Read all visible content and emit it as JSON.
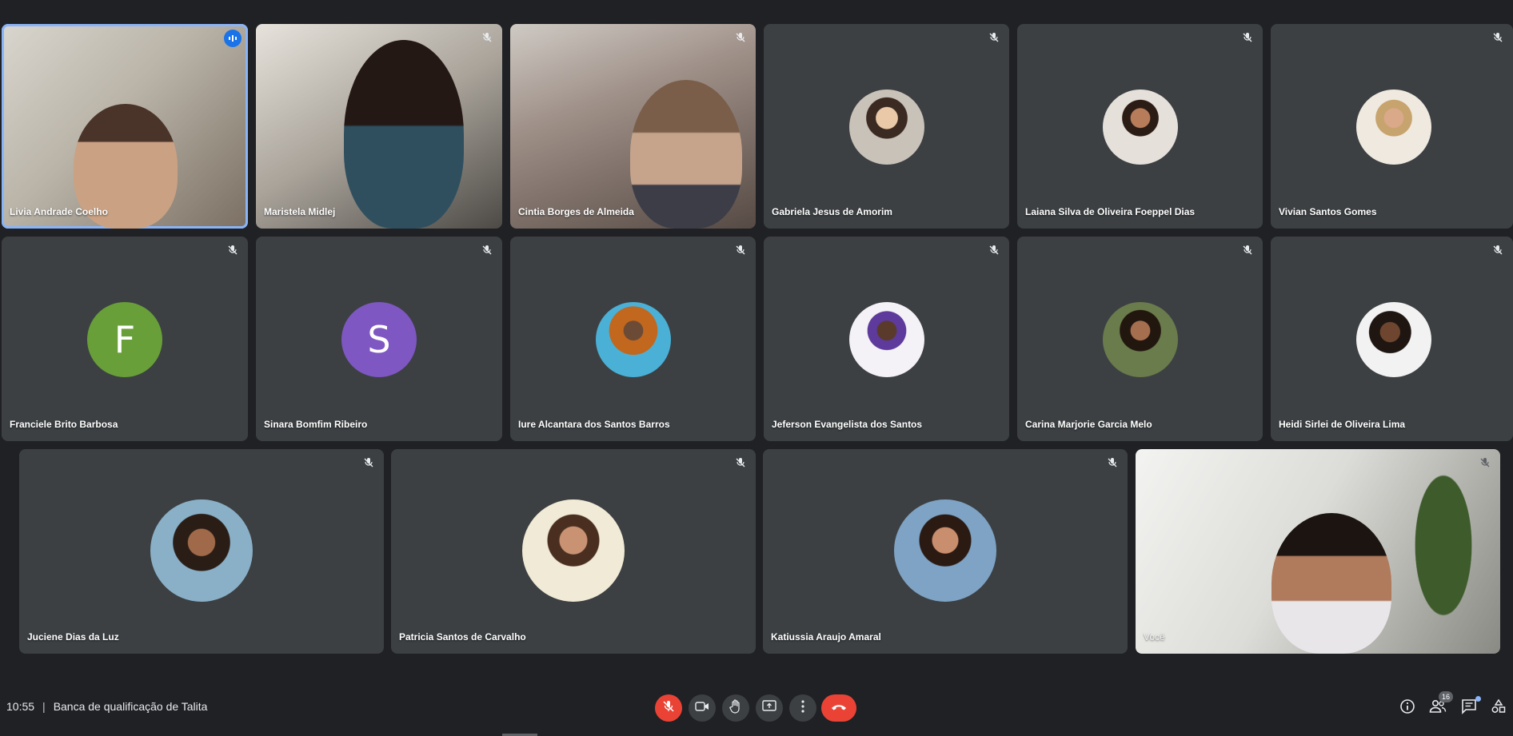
{
  "participants": [
    {
      "name": "Livia Andrade Coelho",
      "speaking": true
    },
    {
      "name": "Maristela Midlej"
    },
    {
      "name": "Cintia Borges de Almeida"
    },
    {
      "name": "Gabriela Jesus de Amorim"
    },
    {
      "name": "Laiana Silva de Oliveira Foeppel Dias"
    },
    {
      "name": "Vivian Santos Gomes"
    },
    {
      "name": "Franciele Brito Barbosa",
      "initial": "F",
      "color": "#689f38"
    },
    {
      "name": "Sinara Bomfim Ribeiro",
      "initial": "S",
      "color": "#7e57c2"
    },
    {
      "name": "Iure Alcantara dos Santos Barros"
    },
    {
      "name": "Jeferson Evangelista dos Santos"
    },
    {
      "name": "Carina Marjorie Garcia Melo"
    },
    {
      "name": "Heidi Sirlei de Oliveira Lima"
    },
    {
      "name": "Juciene Dias da Luz"
    },
    {
      "name": "Patricia Santos de Carvalho"
    },
    {
      "name": "Katiussia Araujo Amaral"
    },
    {
      "name": "Você"
    }
  ],
  "meeting": {
    "time": "10:55",
    "separator": "|",
    "title": "Banca de qualificação de Talita"
  },
  "controls": {
    "participants_count": "16"
  },
  "colors": {
    "background": "#202124",
    "tile": "#3c4043",
    "accent": "#8ab4f8",
    "danger": "#ea4335"
  },
  "icons": [
    "mic-off-icon",
    "camera-icon",
    "raise-hand-icon",
    "present-icon",
    "more-options-icon",
    "end-call-icon",
    "info-icon",
    "people-icon",
    "chat-icon",
    "activities-icon",
    "audio-level-icon"
  ]
}
